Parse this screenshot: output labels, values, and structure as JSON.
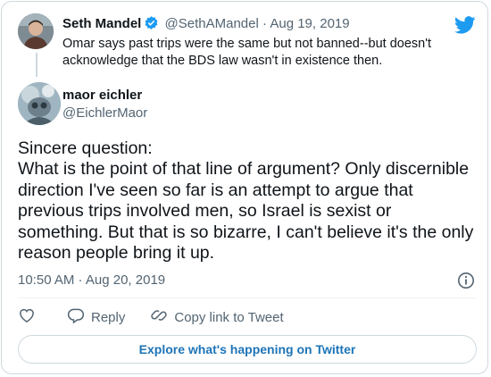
{
  "colors": {
    "accent": "#1d9bf0",
    "link": "#1d74b7",
    "muted": "#536471",
    "border": "#cfd9de"
  },
  "quoted_tweet": {
    "name": "Seth Mandel",
    "handle": "@SethAMandel",
    "separator": "·",
    "date": "Aug 19, 2019",
    "text": "Omar says past trips were the same but not banned--but doesn't acknowledge that the BDS law wasn't in existence then."
  },
  "tweet": {
    "name": "maor eichler",
    "handle": "@EichlerMaor",
    "text": "Sincere question:\nWhat is the point of that line of argument? Only discernible direction I've seen so far is an attempt to argue that previous trips involved men, so Israel is sexist or something. But that is so bizarre, I can't believe it's the only reason people bring it up.",
    "timestamp": "10:50 AM · Aug 20, 2019"
  },
  "actions": {
    "reply_label": "Reply",
    "copy_link_label": "Copy link to Tweet"
  },
  "explore_label": "Explore what's happening on Twitter",
  "icons": [
    "verified-badge-icon",
    "twitter-bird-icon",
    "info-icon",
    "heart-icon",
    "reply-icon",
    "link-icon"
  ]
}
